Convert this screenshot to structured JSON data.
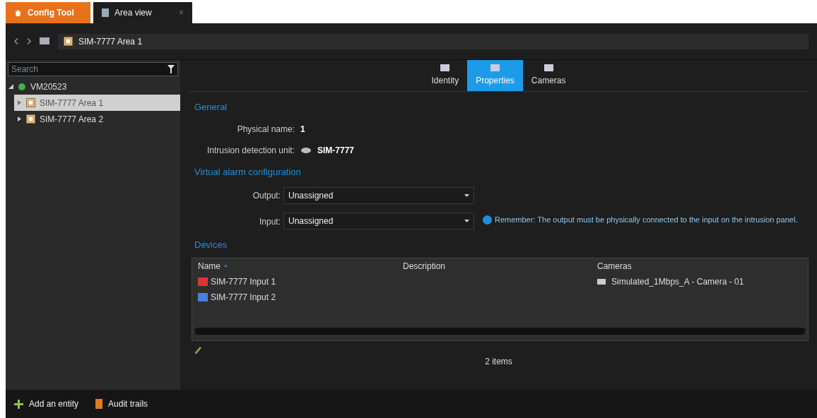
{
  "app_tabs": [
    {
      "label": "Config Tool",
      "kind": "home",
      "selected": false
    },
    {
      "label": "Area view",
      "kind": "page",
      "selected": true,
      "close": "×"
    }
  ],
  "breadcrumb": {
    "label": "SIM-7777 Area 1"
  },
  "search": {
    "placeholder": "Search"
  },
  "tree": [
    {
      "label": "VM20523",
      "expanded": true,
      "selected": false,
      "children": [
        {
          "label": "SIM-7777 Area 1",
          "expanded": false,
          "selected": true
        },
        {
          "label": "SIM-7777 Area 2",
          "expanded": false,
          "selected": false
        }
      ]
    }
  ],
  "view_tabs": [
    {
      "label": "Identity",
      "selected": false
    },
    {
      "label": "Properties",
      "selected": true
    },
    {
      "label": "Cameras",
      "selected": false
    }
  ],
  "general": {
    "heading": "General",
    "physical_name_label": "Physical name:",
    "physical_name": "1",
    "unit_label": "Intrusion detection unit:",
    "unit": "SIM-7777"
  },
  "virtual_alarm": {
    "heading": "Virtual alarm configuration",
    "output_label": "Output:",
    "output": "Unassigned",
    "input_label": "Input:",
    "input": "Unassigned",
    "note": "Remember: The output must be physically connected to the input on the intrusion panel."
  },
  "devices": {
    "heading": "Devices",
    "columns": [
      "Name",
      "Description",
      "Cameras"
    ],
    "sort_mark": "▲",
    "rows": [
      {
        "name": "SIM-7777 Input 1",
        "kind": "red",
        "description": "",
        "camera": "Simulated_1Mbps_A - Camera - 01"
      },
      {
        "name": "SIM-7777 Input 2",
        "kind": "blue",
        "description": "",
        "camera": ""
      }
    ],
    "count": "2 items"
  },
  "footer": [
    {
      "label": "Add an entity",
      "kind": "add"
    },
    {
      "label": "Audit trails",
      "kind": "audit"
    }
  ]
}
